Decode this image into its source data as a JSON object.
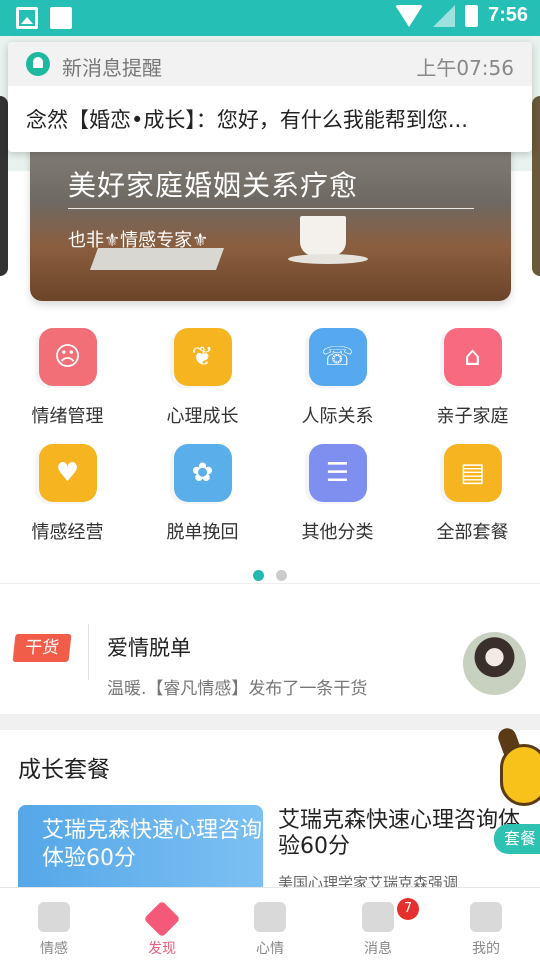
{
  "status_bar": {
    "time": "7:56"
  },
  "notification": {
    "app_name": "新消息提醒",
    "time": "上午07:56",
    "message": "念然【婚恋•成长】：您好，有什么我能帮到您..."
  },
  "banner": {
    "title": "美好家庭婚姻关系疗愈",
    "subtitle": "也非⚜情感专家⚜"
  },
  "categories": [
    {
      "label": "情绪管理",
      "icon": "sad-face-icon",
      "color": "#f36f77"
    },
    {
      "label": "心理成长",
      "icon": "sprout-icon",
      "color": "#f6b421"
    },
    {
      "label": "人际关系",
      "icon": "address-book-icon",
      "color": "#56a8ef"
    },
    {
      "label": "亲子家庭",
      "icon": "house-icon",
      "color": "#f86a7f"
    },
    {
      "label": "情感经营",
      "icon": "heart-lock-icon",
      "color": "#f6b421"
    },
    {
      "label": "脱单挽回",
      "icon": "tulip-icon",
      "color": "#5aaeea"
    },
    {
      "label": "其他分类",
      "icon": "list-icon",
      "color": "#7f8ff0"
    },
    {
      "label": "全部套餐",
      "icon": "document-icon",
      "color": "#f6b421"
    }
  ],
  "carousel": {
    "pages": 2,
    "active": 0
  },
  "news": {
    "tag": "干货",
    "title": "爱情脱单",
    "subtitle": "温暖.【睿凡情感】发布了一条干货"
  },
  "section": {
    "title": "成长套餐"
  },
  "package_card": {
    "image_text": "艾瑞克森快速心理咨询体验60分",
    "title": "艾瑞克森快速心理咨询体验60分",
    "subtitle": "美国心理学家艾瑞克森强调"
  },
  "mascot": {
    "label": "套餐"
  },
  "tabbar": {
    "items": [
      {
        "label": "情感"
      },
      {
        "label": "发现"
      },
      {
        "label": "心情"
      },
      {
        "label": "消息"
      },
      {
        "label": "我的"
      }
    ],
    "active": 1,
    "message_badge": "7"
  }
}
